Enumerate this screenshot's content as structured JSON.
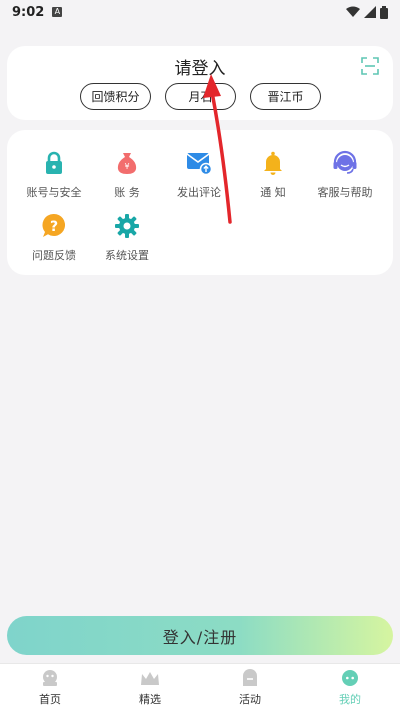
{
  "status": {
    "time": "9:02",
    "notification_badge": "A"
  },
  "header": {
    "title": "请登入"
  },
  "chips": [
    {
      "label": "回馈积分"
    },
    {
      "label": "月石"
    },
    {
      "label": "晋江币"
    }
  ],
  "menu": {
    "items": [
      {
        "label": "账号与安全",
        "icon": "lock-icon",
        "color": "#29b3b0"
      },
      {
        "label": "账 务",
        "icon": "money-bag-icon",
        "color": "#f26d6d"
      },
      {
        "label": "发出评论",
        "icon": "mail-icon",
        "color": "#2e8be6"
      },
      {
        "label": "通 知",
        "icon": "bell-icon",
        "color": "#f4b21b"
      },
      {
        "label": "客服与帮助",
        "icon": "headset-icon",
        "color": "#6e72e6"
      },
      {
        "label": "问题反馈",
        "icon": "question-icon",
        "color": "#f5a623"
      },
      {
        "label": "系统设置",
        "icon": "gear-icon",
        "color": "#19a7a7"
      }
    ]
  },
  "register_button": {
    "label": "登入/注册"
  },
  "tabbar": {
    "tabs": [
      {
        "label": "首页",
        "icon": "home-icon"
      },
      {
        "label": "精选",
        "icon": "crown-icon"
      },
      {
        "label": "活动",
        "icon": "activity-icon"
      },
      {
        "label": "我的",
        "icon": "profile-icon",
        "active": true
      }
    ]
  },
  "colors": {
    "accent": "#64cfb6",
    "background": "#f4f3f5",
    "annotation_arrow": "#e3262b"
  }
}
